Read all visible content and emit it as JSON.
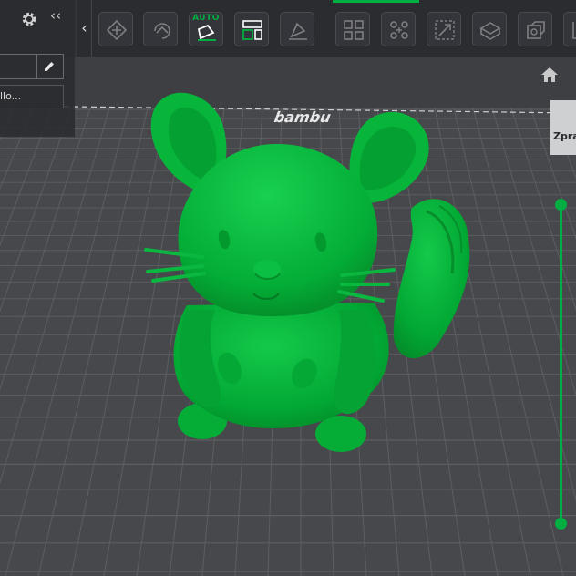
{
  "toolbar": {
    "collapse_glyph": "‹",
    "auto_label": "AUTO",
    "buttons": [
      {
        "name": "add-plate-icon",
        "state": "disabled"
      },
      {
        "name": "auto-orient-icon",
        "state": "disabled"
      },
      {
        "name": "auto-orient-all-icon",
        "state": "enabled"
      },
      {
        "name": "arrange-icon",
        "state": "enabled"
      },
      {
        "name": "lay-on-face-icon",
        "state": "disabled"
      },
      {
        "name": "split-objects-icon",
        "state": "disabled"
      },
      {
        "name": "split-parts-icon",
        "state": "disabled"
      },
      {
        "name": "scale-icon",
        "state": "disabled"
      },
      {
        "name": "slice-plane-icon",
        "state": "disabled"
      },
      {
        "name": "boolean-icon",
        "state": "disabled"
      },
      {
        "name": "measure-icon",
        "state": "disabled"
      }
    ]
  },
  "left_panel": {
    "collapse_glyph": "‹‹",
    "object_item": "llo..."
  },
  "bed_logo": "bambu",
  "view_cube": {
    "face_label": "Zpra"
  },
  "layer_slider": {
    "range": [
      0,
      1
    ]
  },
  "colors": {
    "accent": "#00ae42",
    "model": "#00b23c",
    "bed": "#47484b",
    "grid": "#5d5e61"
  }
}
